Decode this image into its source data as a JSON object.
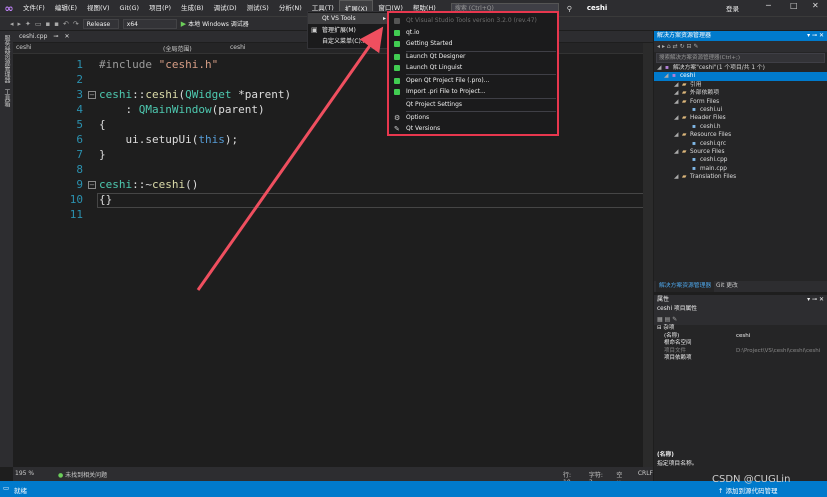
{
  "menubar": {
    "items": [
      "文件(F)",
      "编辑(E)",
      "视图(V)",
      "Git(G)",
      "项目(P)",
      "生成(B)",
      "调试(D)",
      "测试(S)",
      "分析(N)",
      "工具(T)",
      "扩展(X)",
      "窗口(W)",
      "帮助(H)"
    ],
    "search_placeholder": "搜索 (Ctrl+Q)",
    "project": "ceshi",
    "login": "登录"
  },
  "toolbar": {
    "config": "Release",
    "platform": "x64",
    "run_label": "本地 Windows 调试器"
  },
  "left_strip": {
    "tab1": "服务器资源管理器",
    "tab2": "工具箱"
  },
  "editor": {
    "tab_name": "ceshi.cpp",
    "nav_left": "ceshi",
    "nav_mid": "(全局范围)",
    "nav_right": "ceshi",
    "line_numbers": [
      "1",
      "2",
      "3",
      "4",
      "5",
      "6",
      "7",
      "8",
      "9",
      "10",
      "11"
    ],
    "code": {
      "l1_pre": "#include ",
      "l1_str": "\"ceshi.h\"",
      "l3_a": "ceshi",
      "l3_b": "::",
      "l3_c": "ceshi",
      "l3_d": "(",
      "l3_e": "QWidget",
      "l3_f": " *parent)",
      "l4_a": "    : ",
      "l4_b": "QMainWindow",
      "l4_c": "(parent)",
      "l5": "{",
      "l6_a": "    ui.setupUi(",
      "l6_b": "this",
      "l6_c": ");",
      "l7": "}",
      "l9_a": "ceshi",
      "l9_b": "::~",
      "l9_c": "ceshi",
      "l9_d": "()",
      "l10": "{}"
    },
    "status": {
      "zoom": "195 %",
      "issues": "未找到相关问题",
      "line": "行: 10",
      "col": "字符: 3",
      "spaces": "空格",
      "eol": "CRLF"
    }
  },
  "statusbar": {
    "ready": "就绪",
    "add_source": "↑ 添加到源代码管理"
  },
  "solution_explorer": {
    "title": "解决方案资源管理器",
    "search_placeholder": "搜索解决方案资源管理器(Ctrl+;)",
    "items": [
      {
        "label": "解决方案\"ceshi\"(1 个项目/共 1 个)",
        "level": 0
      },
      {
        "label": "ceshi",
        "level": 1,
        "selected": true
      },
      {
        "label": "引用",
        "level": 2
      },
      {
        "label": "外部依赖项",
        "level": 2
      },
      {
        "label": "Form Files",
        "level": 2
      },
      {
        "label": "ceshi.ui",
        "level": 3
      },
      {
        "label": "Header Files",
        "level": 2
      },
      {
        "label": "ceshi.h",
        "level": 3
      },
      {
        "label": "Resource Files",
        "level": 2
      },
      {
        "label": "ceshi.qrc",
        "level": 3
      },
      {
        "label": "Source Files",
        "level": 2
      },
      {
        "label": "ceshi.cpp",
        "level": 3
      },
      {
        "label": "main.cpp",
        "level": 3
      },
      {
        "label": "Translation Files",
        "level": 2
      }
    ],
    "tab1": "解决方案资源管理器",
    "tab2": "Git 更改"
  },
  "properties": {
    "title": "属性",
    "object": "ceshi 项目属性",
    "section": "杂项",
    "rows": [
      {
        "key": "(名称)",
        "value": "ceshi"
      },
      {
        "key": "根命名空间",
        "value": ""
      },
      {
        "key": "项目文件",
        "value": "D:\\Project\\VS\\ceshi\\ceshi\\ceshi"
      },
      {
        "key": "项目依赖项",
        "value": ""
      }
    ],
    "desc_name": "(名称)",
    "desc_text": "指定项目名称。"
  },
  "ext_menu": {
    "items": [
      "Qt VS Tools",
      "管理扩展(M)",
      "自定义菜单(C)..."
    ]
  },
  "qt_menu": {
    "version": "Qt Visual Studio Tools version 3.2.0 (rev.47)",
    "items": [
      "qt.io",
      "Getting Started",
      "Launch Qt Designer",
      "Launch Qt Linguist",
      "Open Qt Project File (.pro)...",
      "Import .pri File to Project...",
      "Qt Project Settings",
      "Options",
      "Qt Versions"
    ]
  },
  "watermark": "CSDN @CUGLin",
  "colors": {
    "accent": "#007acc",
    "highlight_box": "#e8374e",
    "qt_green": "#41cd52"
  }
}
